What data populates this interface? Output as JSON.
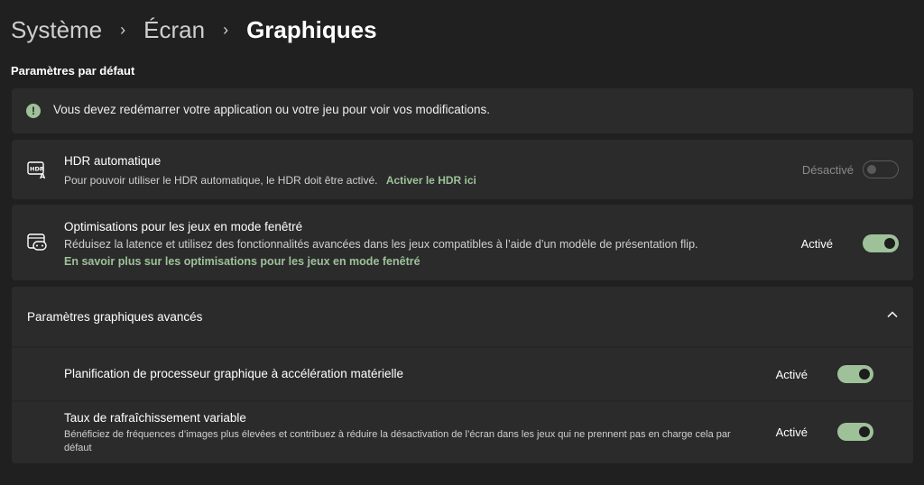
{
  "breadcrumb": {
    "items": [
      "Système",
      "Écran",
      "Graphiques"
    ],
    "separator": "›"
  },
  "section": {
    "title": "Paramètres par défaut"
  },
  "info": {
    "icon": "info-icon",
    "text": "Vous devez redémarrer votre application ou votre jeu pour voir vos modifications."
  },
  "hdr": {
    "icon": "hdr-icon",
    "title": "HDR automatique",
    "description": "Pour pouvoir utiliser le HDR automatique, le HDR doit être activé.",
    "link": "Activer le HDR ici",
    "state": "Désactivé",
    "enabled": false
  },
  "windowed": {
    "icon": "windowed-game-icon",
    "title": "Optimisations pour les jeux en mode fenêtré",
    "description": "Réduisez la latence et utilisez des fonctionnalités avancées dans les jeux compatibles à l’aide d’un modèle de présentation flip.",
    "link": "En savoir plus sur les optimisations pour les jeux en mode fenêtré",
    "state": "Activé",
    "enabled": true
  },
  "advanced": {
    "title": "Paramètres graphiques avancés",
    "expanded": true,
    "items": [
      {
        "title": "Planification de processeur graphique à accélération matérielle",
        "state": "Activé",
        "enabled": true
      },
      {
        "title": "Taux de rafraîchissement variable",
        "description": "Bénéficiez de fréquences d’images plus élevées et contribuez à réduire la désactivation de l’écran dans les jeux qui ne prennent pas en charge cela par défaut",
        "state": "Activé",
        "enabled": true
      }
    ]
  },
  "colors": {
    "background": "#202020",
    "card": "#2b2b2b",
    "accent": "#9ec19a"
  }
}
